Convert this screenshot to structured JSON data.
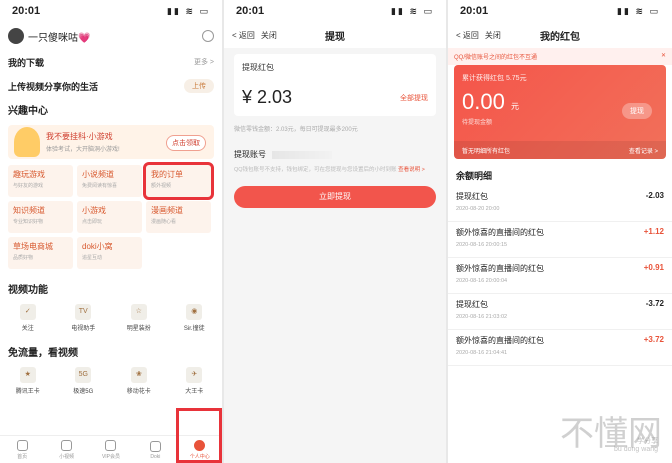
{
  "panel1": {
    "status_time": "20:01",
    "username": "一只傻咪咕💗",
    "downloads": {
      "title": "我的下载",
      "more": "更多 >"
    },
    "upload": {
      "title": "上传视频分享你的生活",
      "button": "上传"
    },
    "interest": {
      "title": "兴趣中心",
      "banner": {
        "title": "我不要挂科·小游戏",
        "sub": "体验考试，大开脑洞小游戏!",
        "button": "点击领取"
      },
      "cells": [
        {
          "title": "趣玩游戏",
          "sub": "与好友的游戏"
        },
        {
          "title": "小说频道",
          "sub": "免费阅读有惊喜"
        },
        {
          "title": "我的订单",
          "sub": "额外视频"
        },
        {
          "title": "知识频道",
          "sub": "专业知识好物"
        },
        {
          "title": "小游戏",
          "sub": "点击即玩"
        },
        {
          "title": "漫画频道",
          "sub": "漫画随心看"
        },
        {
          "title": "草场电商城",
          "sub": "品质好物"
        },
        {
          "title": "doki小窝",
          "sub": "追星互动"
        }
      ]
    },
    "video": {
      "title": "视频功能",
      "items": [
        {
          "icon": "bell-icon",
          "label": "关注"
        },
        {
          "icon": "tv-icon",
          "label": "电视助手"
        },
        {
          "icon": "star-icon",
          "label": "明星装扮"
        },
        {
          "icon": "eye-icon",
          "label": "Sir.撞徒"
        }
      ]
    },
    "free": {
      "title": "免流量，看视频",
      "items": [
        {
          "label": "腾讯王卡"
        },
        {
          "label": "极速5G"
        },
        {
          "label": "移动花卡"
        },
        {
          "label": "大王卡"
        }
      ]
    },
    "tabs": [
      {
        "label": "首页"
      },
      {
        "label": "小视频"
      },
      {
        "label": "VIP会员"
      },
      {
        "label": "Doki"
      },
      {
        "label": "个人中心"
      }
    ]
  },
  "panel2": {
    "status_time": "20:01",
    "back": "< 返回",
    "close": "关闭",
    "title": "提现",
    "label": "提现红包",
    "amount": "¥ 2.03",
    "withdraw_all": "全部提现",
    "note": "微信零钱金额：2.03元，每日可提现最多200元",
    "account_label": "提现账号",
    "tip": "QQ钱包账号不支持，钱包绑定，可在您提现与您设置后的小时到账",
    "tip_link": "查看说明 >",
    "submit": "立即提现"
  },
  "panel3": {
    "status_time": "20:01",
    "back": "< 返回",
    "close": "关闭",
    "title": "我的红包",
    "notice": "QQ/微信账号之间的红包不互通",
    "notice_close": "✕",
    "cumulative": "累计获得红包 5.75元",
    "balance": "0.00",
    "balance_unit": "元",
    "pending": "待提现金额",
    "withdraw_button": "提现",
    "foot_left": "暂无明细所有红包",
    "foot_right": "查看记录 >",
    "ledger_title": "余额明细",
    "entries": [
      {
        "name": "提现红包",
        "date": "2020-08-20 20:00",
        "amount": "-2.03",
        "positive": false
      },
      {
        "name": "额外惊喜的直播间的红包",
        "date": "2020-08-16 20:00:15",
        "amount": "+1.12",
        "positive": true
      },
      {
        "name": "额外惊喜的直播间的红包",
        "date": "2020-08-16 20:00:04",
        "amount": "+0.91",
        "positive": true
      },
      {
        "name": "提现红包",
        "date": "2020-08-16 21:03:02",
        "amount": "-3.72",
        "positive": false
      },
      {
        "name": "额外惊喜的直播间的红包",
        "date": "2020-08-16 21:04:41",
        "amount": "+3.72",
        "positive": true
      }
    ]
  },
  "watermark": {
    "main": "不懂网",
    "sub1": "学分享",
    "sub2": "bu dong wang"
  }
}
